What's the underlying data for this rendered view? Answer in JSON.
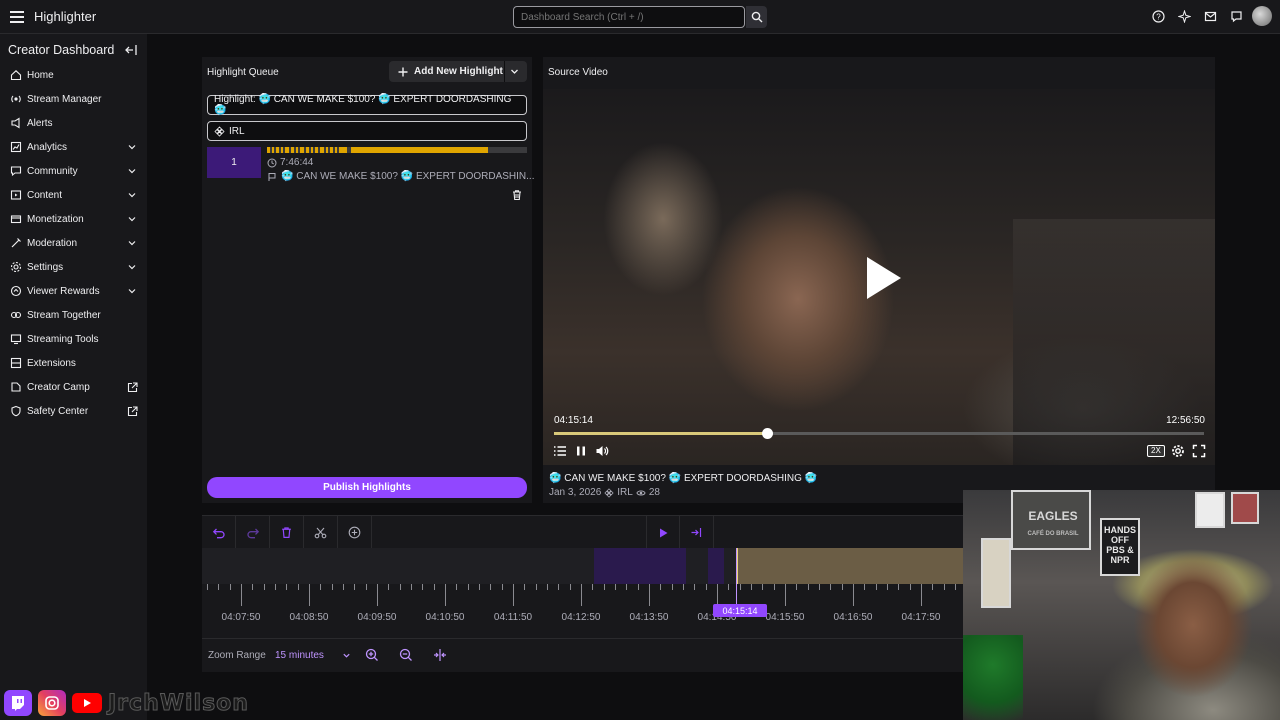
{
  "topbar": {
    "app_title": "Highlighter",
    "search_placeholder": "Dashboard Search (Ctrl + /)"
  },
  "sidebar": {
    "header": "Creator Dashboard",
    "items": [
      {
        "label": "Home",
        "icon": "home-icon",
        "expandable": false
      },
      {
        "label": "Stream Manager",
        "icon": "stream-manager-icon",
        "expandable": false
      },
      {
        "label": "Alerts",
        "icon": "alerts-icon",
        "expandable": false
      },
      {
        "label": "Analytics",
        "icon": "analytics-icon",
        "expandable": true
      },
      {
        "label": "Community",
        "icon": "community-icon",
        "expandable": true
      },
      {
        "label": "Content",
        "icon": "content-icon",
        "expandable": true
      },
      {
        "label": "Monetization",
        "icon": "monetization-icon",
        "expandable": true
      },
      {
        "label": "Moderation",
        "icon": "moderation-icon",
        "expandable": true
      },
      {
        "label": "Settings",
        "icon": "settings-icon",
        "expandable": true
      },
      {
        "label": "Viewer Rewards",
        "icon": "viewer-rewards-icon",
        "expandable": true
      },
      {
        "label": "Stream Together",
        "icon": "stream-together-icon",
        "expandable": false
      },
      {
        "label": "Streaming Tools",
        "icon": "streaming-tools-icon",
        "expandable": false
      },
      {
        "label": "Extensions",
        "icon": "extensions-icon",
        "expandable": false
      },
      {
        "label": "Creator Camp",
        "icon": "creator-camp-icon",
        "external": true
      },
      {
        "label": "Safety Center",
        "icon": "safety-center-icon",
        "external": true
      }
    ]
  },
  "queue": {
    "title": "Highlight Queue",
    "add_label": "Add New Highlight",
    "highlight_title": "Highlight: 🥶 CAN WE MAKE $100? 🥶 EXPERT DOORDASHING 🥶",
    "category": "IRL",
    "clip": {
      "number": "1",
      "duration": "7:46:44",
      "title": "🥶 CAN WE MAKE $100? 🥶 EXPERT DOORDASHIN..."
    },
    "publish_label": "Publish Highlights"
  },
  "source": {
    "title": "Source Video",
    "current_time": "04:15:14",
    "total_time": "12:56:50",
    "progress": 0.327,
    "speed": "2X",
    "video_title": "🥶 CAN WE MAKE $100? 🥶 EXPERT DOORDASHING 🥶",
    "date": "Jan 3, 2026",
    "category": "IRL",
    "views": "28"
  },
  "timeline": {
    "tick_labels": [
      "04:07:50",
      "04:08:50",
      "04:09:50",
      "04:10:50",
      "04:11:50",
      "04:12:50",
      "04:13:50",
      "04:14:50",
      "04:15:50",
      "04:16:50",
      "04:17:50"
    ],
    "playhead_label": "04:15:14",
    "zoom_label": "Zoom Range",
    "zoom_value": "15 minutes"
  },
  "webcam": {
    "poster1": "EAGLES",
    "poster2_line1": "HANDS",
    "poster2_line2": "OFF",
    "poster2_line3": "PBS &",
    "poster2_line4": "NPR",
    "poster3": "CAFÉ DO BRASIL"
  },
  "overlay": {
    "handle": "JrchWilson"
  },
  "colors": {
    "accent": "#9147ff",
    "highlight_bar": "#e0a500",
    "background": "#0e0e10",
    "panel": "#18181b"
  }
}
